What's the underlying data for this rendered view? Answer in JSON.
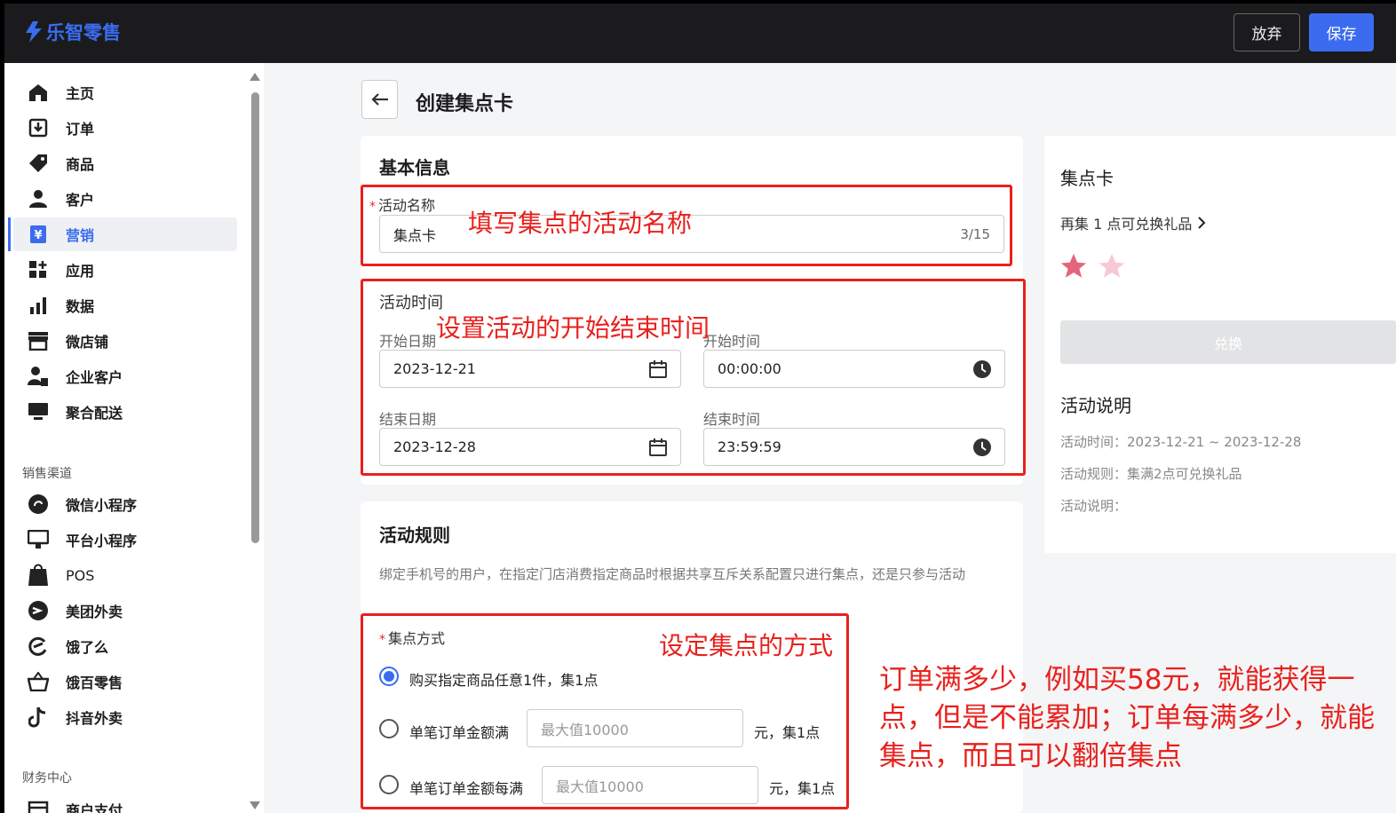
{
  "app": {
    "brand": "乐智零售",
    "accent": "#3b6cf0",
    "annotation_color": "#e8211d"
  },
  "topbar": {
    "discard_label": "放弃",
    "save_label": "保存"
  },
  "sidebar": {
    "items": [
      {
        "label": "主页",
        "icon": "home-icon"
      },
      {
        "label": "订单",
        "icon": "order-icon"
      },
      {
        "label": "商品",
        "icon": "tag-icon"
      },
      {
        "label": "客户",
        "icon": "person-icon"
      },
      {
        "label": "营销",
        "icon": "yen-icon",
        "active": true
      },
      {
        "label": "应用",
        "icon": "apps-icon"
      },
      {
        "label": "数据",
        "icon": "bar-chart-icon"
      },
      {
        "label": "微店铺",
        "icon": "store-icon"
      },
      {
        "label": "企业客户",
        "icon": "enterprise-user-icon"
      },
      {
        "label": "聚合配送",
        "icon": "monitor-icon"
      }
    ],
    "section_channels": "销售渠道",
    "channels": [
      {
        "label": "微信小程序",
        "icon": "miniprogram-icon"
      },
      {
        "label": "平台小程序",
        "icon": "platform-icon"
      },
      {
        "label": "POS",
        "icon": "pos-bag-icon"
      },
      {
        "label": "美团外卖",
        "icon": "meituan-icon"
      },
      {
        "label": "饿了么",
        "icon": "eleme-icon"
      },
      {
        "label": "饿百零售",
        "icon": "basket-icon"
      },
      {
        "label": "抖音外卖",
        "icon": "tiktok-icon"
      }
    ],
    "section_finance": "财务中心",
    "finance": [
      {
        "label": "商户支付",
        "icon": "payment-icon"
      }
    ]
  },
  "page": {
    "title": "创建集点卡"
  },
  "basic_info": {
    "title": "基本信息",
    "name_label": "活动名称",
    "name_required": "*",
    "name_value": "集点卡",
    "name_counter": "3/15",
    "time_title": "活动时间",
    "start_date_label": "开始日期",
    "start_date": "2023-12-21",
    "start_time_label": "开始时间",
    "start_time": "00:00:00",
    "end_date_label": "结束日期",
    "end_date": "2023-12-28",
    "end_time_label": "结束时间",
    "end_time": "23:59:59"
  },
  "rules": {
    "title": "活动规则",
    "description": "绑定手机号的用户，在指定门店消费指定商品时根据共享互斥关系配置只进行集点，还是只参与活动",
    "method_label": "集点方式",
    "method_required": "*",
    "options": [
      {
        "label": "购买指定商品任意1件，集1点",
        "selected": true
      },
      {
        "label": "单笔订单金额满",
        "placeholder": "最大值10000",
        "suffix": "元，集1点",
        "selected": false
      },
      {
        "label": "单笔订单金额每满",
        "placeholder": "最大值10000",
        "suffix": "元，集1点",
        "selected": false
      }
    ]
  },
  "preview": {
    "title": "集点卡",
    "subtitle": "再集 1 点可兑换礼品",
    "stars_total": 2,
    "stars_filled": 1,
    "redeem_label": "兑换",
    "info_title": "活动说明",
    "time_line": "活动时间：2023-12-21 ~ 2023-12-28",
    "rule_line": "活动规则：集满2点可兑换礼品",
    "desc_line": "活动说明："
  },
  "annotations": {
    "name": "填写集点的活动名称",
    "time": "设置活动的开始结束时间",
    "method": "设定集点的方式",
    "explain": "订单满多少，例如买58元，就能获得一点，但是不能累加；订单每满多少，就能集点，而且可以翻倍集点"
  }
}
